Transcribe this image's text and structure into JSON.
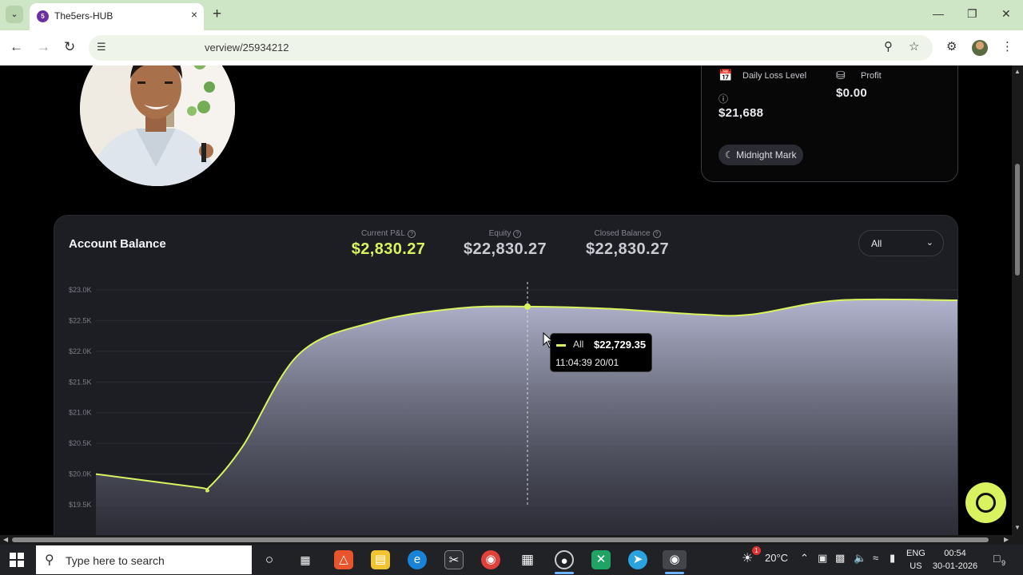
{
  "browser": {
    "tab_title": "The5ers-HUB",
    "tab_favicon": "5ers",
    "url_text": "verview/25934212",
    "tab_close": "×",
    "new_tab": "+"
  },
  "objectives": {
    "daily_loss_label": "Daily Loss Level",
    "daily_loss_value": "$21,688",
    "profit_label": "Profit",
    "profit_value": "$0.00",
    "reset_chip": "Midnight Mark"
  },
  "balance": {
    "title": "Account Balance",
    "stats": [
      {
        "label": "Current P&L",
        "value": "$2,830.27"
      },
      {
        "label": "Equity",
        "value": "$22,830.27"
      },
      {
        "label": "Closed Balance",
        "value": "$22,830.27"
      }
    ],
    "range": "All"
  },
  "tooltip": {
    "series": "All",
    "value": "$22,729.35",
    "time": "11:04:39 20/01"
  },
  "chart_data": {
    "type": "area",
    "y_ticks": [
      "$23.0K",
      "$22.5K",
      "$22.0K",
      "$21.5K",
      "$21.0K",
      "$20.5K",
      "$20.0K",
      "$19.5K"
    ],
    "ylim": [
      19500,
      23000
    ],
    "grid": true,
    "line_color": "#d8f35f",
    "series": [
      {
        "name": "All",
        "x": [
          0,
          0.12,
          0.13,
          0.17,
          0.235,
          0.32,
          0.42,
          0.5,
          0.6,
          0.7,
          0.76,
          0.86,
          1.0
        ],
        "values": [
          20000,
          19780,
          19770,
          20450,
          21950,
          22470,
          22700,
          22729,
          22690,
          22600,
          22600,
          22830,
          22830
        ]
      }
    ],
    "highlight_index": 7,
    "line_color_hint": "lime"
  },
  "taskbar": {
    "search_placeholder": "Type here to search",
    "weather": "20°C",
    "lang_top": "ENG",
    "lang_bottom": "US",
    "time": "00:54",
    "date": "30-01-2026",
    "notification_count": "9",
    "weather_badge": "1"
  }
}
